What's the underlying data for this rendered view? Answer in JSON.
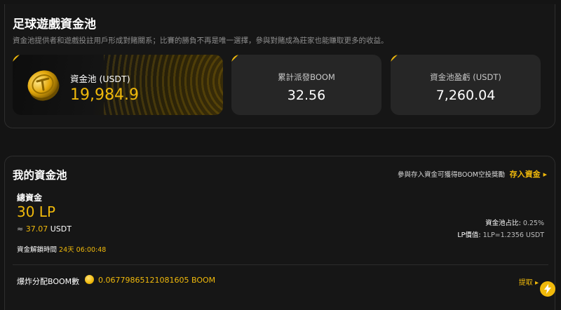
{
  "header": {
    "title": "足球遊戲資金池",
    "subtitle": "資金池提供者和遊戲投註用戶形成對賭關系；比賽的勝負不再是唯一選擇，參與對賭成為莊家也能賺取更多的收益。"
  },
  "cards": {
    "pool": {
      "label": "資金池 (USDT)",
      "value": "19,984.9"
    },
    "boom": {
      "label": "累計派發BOOM",
      "value": "32.56"
    },
    "profit": {
      "label": "資金池盈虧 (USDT)",
      "value": "7,260.04"
    }
  },
  "my_pool": {
    "title": "我的資金池",
    "deposit_hint": "參與存入資金可獲得BOOM空投獎勵",
    "deposit_label": "存入資金 ▸",
    "total_label": "總資金",
    "total_value": "30 LP",
    "approx_prefix": "≈",
    "approx_value": "37.07",
    "approx_unit": "USDT",
    "share_label": "資金池占比:",
    "share_value": "0.25%",
    "lp_price_label": "LP價值:",
    "lp_price_value": "1LP=1.2356 USDT",
    "unlock_label": "資金解鎖時間",
    "unlock_value": "24天 06:00:48",
    "boom_label": "爆炸分配BOOM數",
    "boom_value": "0.0677986512108160​5 BOOM",
    "withdraw_label": "提取 ▸"
  },
  "colors": {
    "accent": "#f0b90b",
    "card_bg": "#262626",
    "page_bg": "#141414"
  },
  "icons": {
    "coin": "gold-coin-icon",
    "fab": "lightning-icon"
  }
}
